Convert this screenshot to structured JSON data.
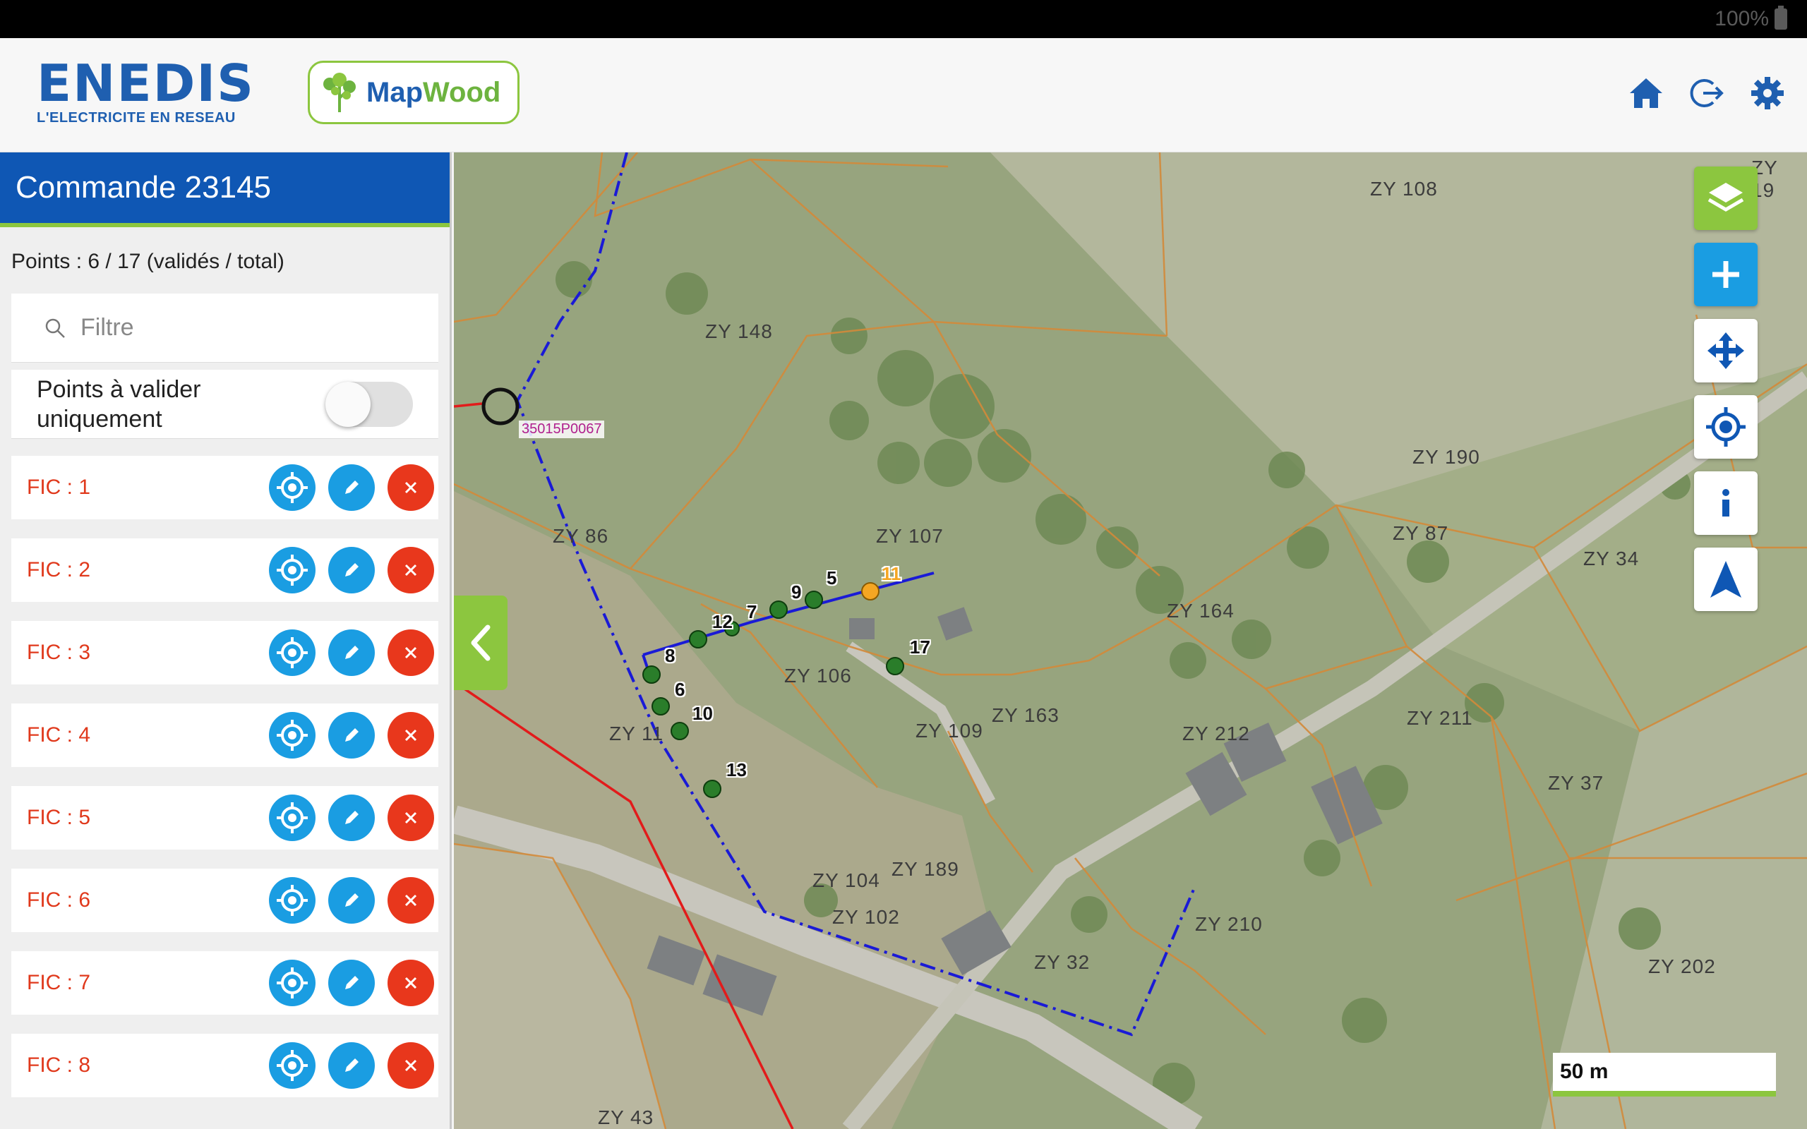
{
  "statusbar": {
    "battery": "100%"
  },
  "header": {
    "brand": "ENEDIS",
    "brand_tagline": "L'ELECTRICITE EN RESEAU",
    "app_logo_part1": "Map",
    "app_logo_part2": "Wood",
    "icons": [
      "home-icon",
      "logout-icon",
      "settings-icon"
    ]
  },
  "sidebar": {
    "title": "Commande 23145",
    "points_summary": "Points : 6 / 17 (validés / total)",
    "filter_placeholder": "Filtre",
    "toggle_label": "Points à valider uniquement",
    "toggle_on": false,
    "items": [
      {
        "label": "FIC : 1"
      },
      {
        "label": "FIC : 2"
      },
      {
        "label": "FIC : 3"
      },
      {
        "label": "FIC : 4"
      },
      {
        "label": "FIC : 5"
      },
      {
        "label": "FIC : 6"
      },
      {
        "label": "FIC : 7"
      },
      {
        "label": "FIC : 8"
      }
    ]
  },
  "map": {
    "scale_label": "50 m",
    "site_tag": "35015P0067",
    "parcels": [
      "ZY 108",
      "ZY 148",
      "ZY 190",
      "ZY 87",
      "ZY 34",
      "ZY 86",
      "ZY 107",
      "ZY 164",
      "ZY 106",
      "ZY 163",
      "ZY 109",
      "ZY 212",
      "ZY 211",
      "ZY 37",
      "ZY 11",
      "ZY 104",
      "ZY 189",
      "ZY 102",
      "ZY 210",
      "ZY 32",
      "ZY 202",
      "ZY 43",
      "ZY 19"
    ],
    "points": [
      {
        "label": "5",
        "status": "valid"
      },
      {
        "label": "6",
        "status": "valid"
      },
      {
        "label": "7",
        "status": "valid"
      },
      {
        "label": "8",
        "status": "valid"
      },
      {
        "label": "9",
        "status": "valid"
      },
      {
        "label": "10",
        "status": "valid"
      },
      {
        "label": "11",
        "status": "pending"
      },
      {
        "label": "12",
        "status": "valid"
      },
      {
        "label": "13",
        "status": "valid"
      },
      {
        "label": "17",
        "status": "valid"
      }
    ],
    "tools": [
      "layers-icon",
      "add-icon",
      "move-icon",
      "locate-icon",
      "info-icon",
      "navigation-icon"
    ]
  },
  "colors": {
    "brand_blue": "#0f57b4",
    "accent_green": "#8cc63f",
    "button_blue": "#1a9de2",
    "delete_red": "#e8371c",
    "fic_text": "#e0391c",
    "point_valid": "#1e7a1e",
    "point_pending": "#f5a623"
  }
}
